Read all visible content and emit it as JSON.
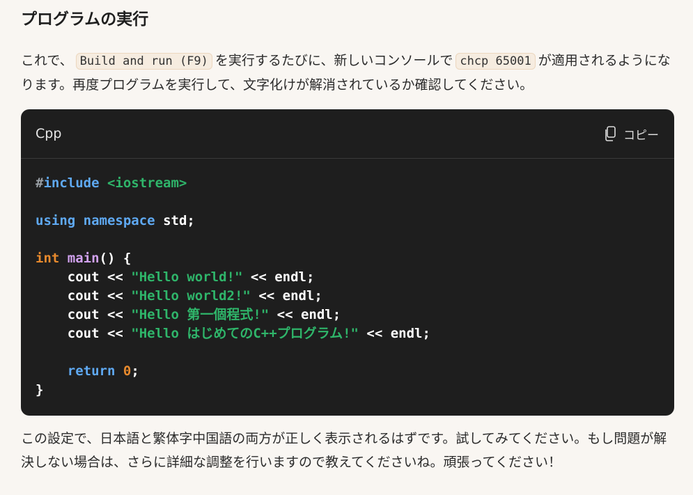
{
  "heading": "プログラムの実行",
  "para1": {
    "t1": "これで、",
    "code1": "Build and run (F9)",
    "t2": "を実行するたびに、新しいコンソールで",
    "code2": "chcp 65001",
    "t3": "が適用されるようになります。再度プログラムを実行して、文字化けが解消されているか確認してください。"
  },
  "code_block": {
    "language": "Cpp",
    "copy_label": "コピー",
    "lines": {
      "l1_hash": "#",
      "l1_include": "include",
      "l1_header": "<iostream>",
      "l3_using": "using",
      "l3_namespace": "namespace",
      "l3_rest": "std;",
      "l5_int": "int",
      "l5_main": "main",
      "l5_rest": "() {",
      "l6_pre": "    cout << ",
      "l6_str": "\"Hello world!\"",
      "l6_post": " << endl;",
      "l7_pre": "    cout << ",
      "l7_str": "\"Hello world2!\"",
      "l7_post": " << endl;",
      "l8_pre": "    cout << ",
      "l8_str": "\"Hello 第一個程式!\"",
      "l8_post": " << endl;",
      "l9_pre": "    cout << ",
      "l9_str": "\"Hello はじめてのC++プログラム!\"",
      "l9_post": " << endl;",
      "l11_indent": "    ",
      "l11_return": "return",
      "l11_num": "0",
      "l11_end": ";",
      "l12_close": "}"
    }
  },
  "para2": "この設定で、日本語と繁体字中国語の両方が正しく表示されるはずです。試してみてください。もし問題が解決しない場合は、さらに詳細な調整を行いますので教えてくださいね。頑張ってください！",
  "colors": {
    "page_bg": "#f9f6f2",
    "code_bg": "#1e1e1e",
    "keyword_blue": "#5fa9f2",
    "keyword_orange": "#e88a2d",
    "function_purple": "#d2a2f0",
    "string_green": "#2fb56a"
  },
  "icons": {
    "copy": "copy-icon"
  }
}
